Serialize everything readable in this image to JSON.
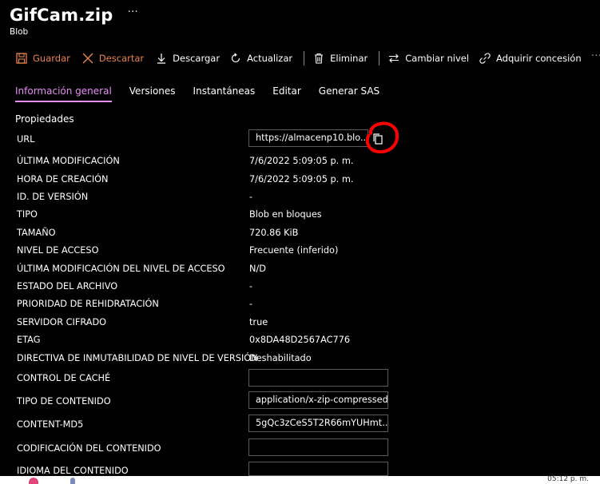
{
  "header": {
    "title": "GifCam.zip",
    "subtitle": "Blob",
    "more": "···"
  },
  "toolbar": {
    "save": "Guardar",
    "discard": "Descartar",
    "download": "Descargar",
    "refresh": "Actualizar",
    "delete": "Eliminar",
    "change_tier": "Cambiar nivel",
    "acquire_lease": "Adquirir concesión",
    "more": "···"
  },
  "tabs": [
    "Información general",
    "Versiones",
    "Instantáneas",
    "Editar",
    "Generar SAS"
  ],
  "section_title": "Propiedades",
  "properties": [
    {
      "label": "URL",
      "value": "https://almacenp10.blo..."
    },
    {
      "label": "ÚLTIMA MODIFICACIÓN",
      "value": "7/6/2022 5:09:05 p. m."
    },
    {
      "label": "HORA DE CREACIÓN",
      "value": "7/6/2022 5:09:05 p. m."
    },
    {
      "label": "ID. DE VERSIÓN",
      "value": "-"
    },
    {
      "label": "TIPO",
      "value": "Blob en bloques"
    },
    {
      "label": "TAMAÑO",
      "value": "720.86 KiB"
    },
    {
      "label": "NIVEL DE ACCESO",
      "value": "Frecuente (inferido)"
    },
    {
      "label": "ÚLTIMA MODIFICACIÓN DEL NIVEL DE ACCESO",
      "value": "N/D"
    },
    {
      "label": "ESTADO DEL ARCHIVO",
      "value": "-"
    },
    {
      "label": "PRIORIDAD DE REHIDRATACIÓN",
      "value": "-"
    },
    {
      "label": "SERVIDOR CIFRADO",
      "value": "true"
    },
    {
      "label": "ETAG",
      "value": "0x8DA48D2567AC776"
    },
    {
      "label": "DIRECTIVA DE INMUTABILIDAD DE NIVEL DE VERSIÓN",
      "value": "Deshabilitado"
    },
    {
      "label": "CONTROL DE CACHÉ",
      "value": ""
    },
    {
      "label": "TIPO DE CONTENIDO",
      "value": "application/x-zip-compressed"
    },
    {
      "label": "CONTENT-MD5",
      "value": "5gQc3zCeS5T2R66mYUHmt..."
    },
    {
      "label": "CODIFICACIÓN DEL CONTENIDO",
      "value": ""
    },
    {
      "label": "IDIOMA DEL CONTENIDO",
      "value": ""
    }
  ],
  "taskbar": {
    "time": "05:12 p. m."
  },
  "colors": {
    "accent_orange": "#e8834a",
    "tab_active": "#e78ef5",
    "annotation_red": "#ff0000"
  }
}
